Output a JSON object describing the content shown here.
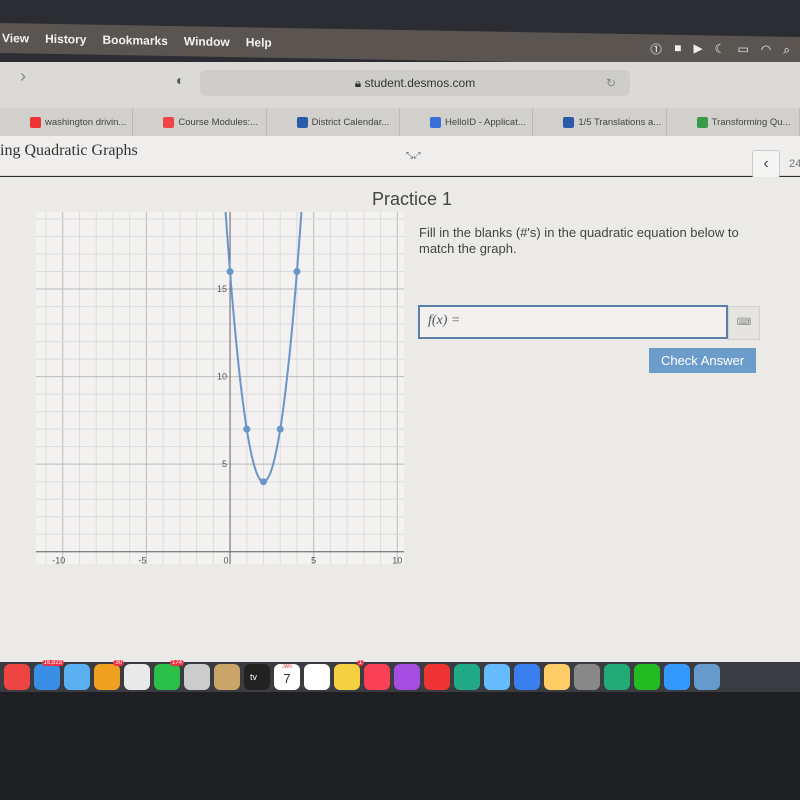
{
  "menubar": {
    "items": [
      "View",
      "History",
      "Bookmarks",
      "Window",
      "Help"
    ]
  },
  "browser": {
    "url": "student.desmos.com"
  },
  "tabs": [
    {
      "label": "washington drivin...",
      "color": "#e33"
    },
    {
      "label": "Course Modules:...",
      "color": "#e44"
    },
    {
      "label": "District Calendar...",
      "color": "#2a5ba8"
    },
    {
      "label": "HelloID - Applicat...",
      "color": "#3a6fd8"
    },
    {
      "label": "1/5 Translations a...",
      "color": "#2a5ba8"
    },
    {
      "label": "Transforming Qu...",
      "color": "#3a9a4a"
    }
  ],
  "header": {
    "title": "ing Quadratic Graphs",
    "page_number": "24"
  },
  "practice": {
    "title": "Practice 1",
    "instructions": "Fill in the blanks (#'s) in the quadratic equation below to match the graph.",
    "input_label": "f(x) =",
    "input_value": "",
    "check_button": "Check Answer"
  },
  "colors": {
    "curve": "#6a95c9",
    "button": "#6c9cc9",
    "input_border": "#5b7fa8"
  },
  "chart_data": {
    "type": "line",
    "xlim": [
      -11.6,
      10.4
    ],
    "ylim": [
      -0.7,
      19.4
    ],
    "grid": true,
    "grid_step": 1,
    "x_tick_labels": [
      "-10",
      "-5",
      "0",
      "5",
      "10"
    ],
    "y_tick_labels": [
      "5",
      "10",
      "15"
    ],
    "x_ticks": [
      -10,
      -5,
      0,
      5,
      10
    ],
    "y_ticks": [
      5,
      10,
      15
    ],
    "curve": {
      "a": 3,
      "h": 2,
      "k": 4
    },
    "points": [
      [
        0,
        16
      ],
      [
        1,
        7
      ],
      [
        2,
        4
      ],
      [
        3,
        7
      ],
      [
        4,
        16
      ]
    ]
  },
  "dock": {
    "badges": [
      "16,823",
      "30",
      "174",
      "1"
    ],
    "calendar": {
      "month": "JAN",
      "day": "7"
    },
    "tv_label": "tv"
  }
}
